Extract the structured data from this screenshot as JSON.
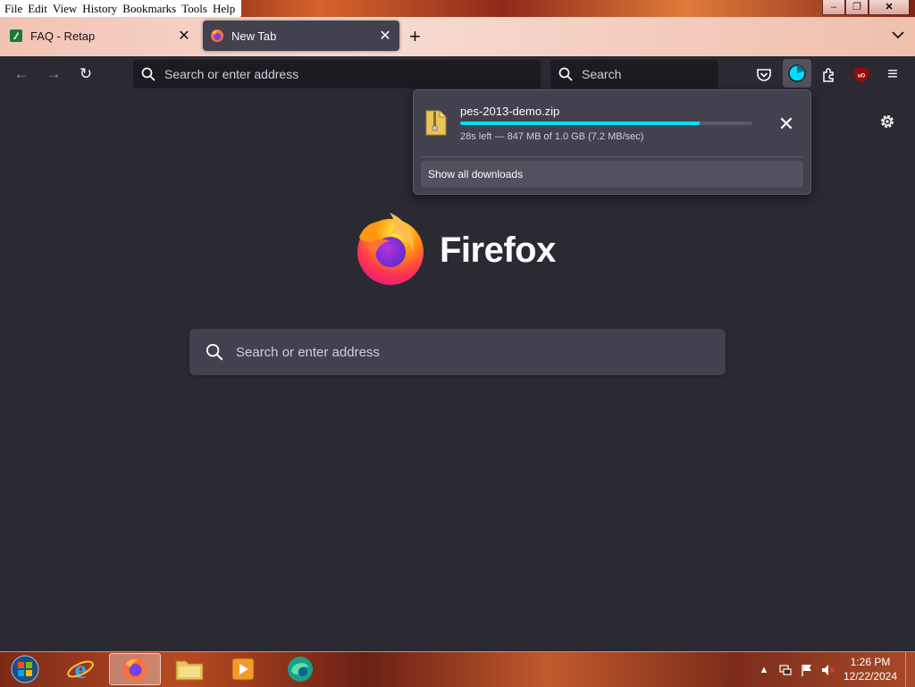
{
  "menu": [
    "File",
    "Edit",
    "View",
    "History",
    "Bookmarks",
    "Tools",
    "Help"
  ],
  "window_controls": {
    "minimize": "–",
    "restore": "❐",
    "close": "✕"
  },
  "tabs": [
    {
      "title": "FAQ - Retap",
      "close": "✕"
    },
    {
      "title": "New Tab",
      "close": "✕"
    }
  ],
  "tabstrip": {
    "new_tab": "+",
    "list_all": "⌄"
  },
  "navbar": {
    "back": "←",
    "forward": "→",
    "reload": "↻",
    "url_placeholder": "Search or enter address",
    "search_placeholder": "Search",
    "menu": "≡"
  },
  "colors": {
    "accent": "#00ddff",
    "toolbar_bg": "#2b2a33",
    "panel_bg": "#42414d",
    "ublock_red": "#9b0a0a"
  },
  "download": {
    "filename": "pes-2013-demo.zip",
    "progress": 0.82,
    "status": "28s left — 847 MB of 1.0 GB (7.2 MB/sec)",
    "cancel": "✕",
    "show_all": "Show all downloads"
  },
  "newtab": {
    "brand": "Firefox",
    "search_placeholder": "Search or enter address"
  },
  "taskbar": {
    "apps": [
      "start-orb",
      "internet-explorer",
      "firefox",
      "file-explorer",
      "media-player",
      "edge-browser"
    ],
    "time": "1:26 PM",
    "date": "12/22/2024"
  }
}
